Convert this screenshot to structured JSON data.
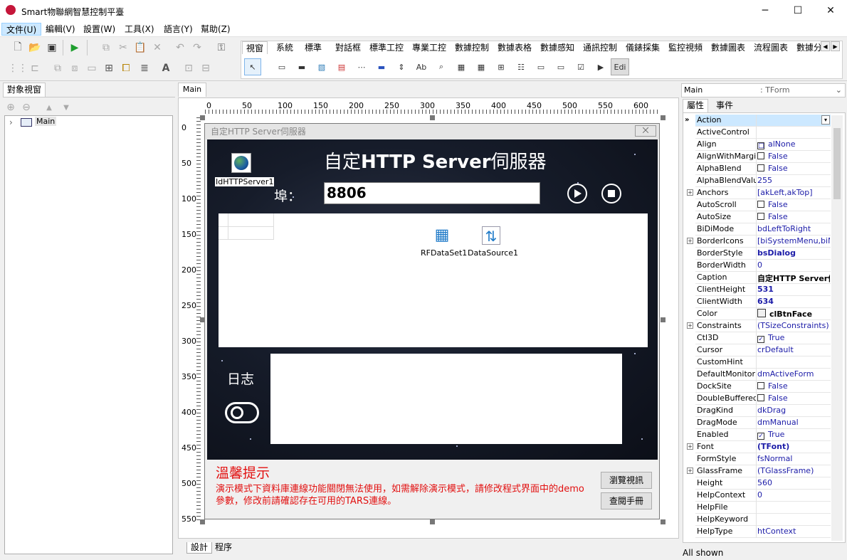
{
  "window": {
    "title": "Smart物聯網智慧控制平臺",
    "min": "─",
    "max": "☐",
    "close": "✕"
  },
  "menu": [
    "文件(U)",
    "編輯(V)",
    "設置(W)",
    "工具(X)",
    "語言(Y)",
    "幫助(Z)"
  ],
  "palette_tabs": [
    "視窗",
    "系統",
    "標準",
    "對話框",
    "標準工控",
    "專業工控",
    "數據控制",
    "數據表格",
    "數據感知",
    "通訊控制",
    "儀錶採集",
    "監控視頻",
    "數據圖表",
    "流程圖表",
    "數據分"
  ],
  "palette_scroll": {
    "left": "◀",
    "right": "▶"
  },
  "edit_component": "Edi",
  "object_view": {
    "tab": "對象視窗",
    "tree_root": "Main",
    "expander": "›"
  },
  "designer": {
    "tab": "Main",
    "bottom_tabs": [
      "設計",
      "程序"
    ],
    "ruler_h": [
      "0",
      "50",
      "100",
      "150",
      "200",
      "250",
      "300",
      "350",
      "400",
      "450",
      "500",
      "550",
      "600"
    ],
    "ruler_v": [
      "0",
      "50",
      "100",
      "150",
      "200",
      "250",
      "300",
      "350",
      "400",
      "450",
      "500",
      "550"
    ]
  },
  "form": {
    "caption": "自定HTTP Server伺服器",
    "close_glyph": "⨉",
    "heading_prefix": "自定",
    "heading_bold": "HTTP Server",
    "heading_suffix": "伺服器",
    "port_label": "埠：",
    "port_value": "8806",
    "components": [
      "IdHTTPServer1",
      "RFDataSet1",
      "DataSource1"
    ],
    "log_label": "日志",
    "tip_title": "溫馨提示",
    "tip_text": "演示模式下資料庫連線功能關閉無法使用，如需解除演示模式，請修改程式界面中的demo參數，修改前請確認存在可用的TARS連線。",
    "btn_browse": "瀏覽視訊",
    "btn_manual": "查閱手冊"
  },
  "props": {
    "selector_name": "Main",
    "selector_type": ": TForm",
    "tabs": [
      "屬性",
      "事件"
    ],
    "status": "All shown",
    "rows": [
      {
        "name": "Action",
        "value": "",
        "selected": true
      },
      {
        "name": "ActiveControl",
        "value": ""
      },
      {
        "name": "Align",
        "value": "alNone",
        "icon": "□"
      },
      {
        "name": "AlignWithMargins",
        "value": "False",
        "check": ""
      },
      {
        "name": "AlphaBlend",
        "value": "False",
        "check": ""
      },
      {
        "name": "AlphaBlendValue",
        "value": "255"
      },
      {
        "name": "Anchors",
        "value": "[akLeft,akTop]",
        "plus": "+"
      },
      {
        "name": "AutoScroll",
        "value": "False",
        "check": ""
      },
      {
        "name": "AutoSize",
        "value": "False",
        "check": ""
      },
      {
        "name": "BiDiMode",
        "value": "bdLeftToRight"
      },
      {
        "name": "BorderIcons",
        "value": "[biSystemMenu,biMini",
        "plus": "+"
      },
      {
        "name": "BorderStyle",
        "value": "bsDialog",
        "style": "boldblue"
      },
      {
        "name": "BorderWidth",
        "value": "0"
      },
      {
        "name": "Caption",
        "value": "自定HTTP Server伺服器",
        "style": "bold"
      },
      {
        "name": "ClientHeight",
        "value": "531",
        "style": "boldblue"
      },
      {
        "name": "ClientWidth",
        "value": "634",
        "style": "boldblue"
      },
      {
        "name": "Color",
        "value": "clBtnFace",
        "style": "bold",
        "swatch": true
      },
      {
        "name": "Constraints",
        "value": "(TSizeConstraints)",
        "plus": "+"
      },
      {
        "name": "Ctl3D",
        "value": "True",
        "check": "✓"
      },
      {
        "name": "Cursor",
        "value": "crDefault"
      },
      {
        "name": "CustomHint",
        "value": ""
      },
      {
        "name": "DefaultMonitor",
        "value": "dmActiveForm"
      },
      {
        "name": "DockSite",
        "value": "False",
        "check": ""
      },
      {
        "name": "DoubleBuffered",
        "value": "False",
        "check": ""
      },
      {
        "name": "DragKind",
        "value": "dkDrag"
      },
      {
        "name": "DragMode",
        "value": "dmManual"
      },
      {
        "name": "Enabled",
        "value": "True",
        "check": "✓"
      },
      {
        "name": "Font",
        "value": "(TFont)",
        "plus": "+",
        "style": "boldblue"
      },
      {
        "name": "FormStyle",
        "value": "fsNormal"
      },
      {
        "name": "GlassFrame",
        "value": "(TGlassFrame)",
        "plus": "+"
      },
      {
        "name": "Height",
        "value": "560"
      },
      {
        "name": "HelpContext",
        "value": "0"
      },
      {
        "name": "HelpFile",
        "value": ""
      },
      {
        "name": "HelpKeyword",
        "value": ""
      },
      {
        "name": "HelpType",
        "value": "htContext"
      }
    ]
  }
}
